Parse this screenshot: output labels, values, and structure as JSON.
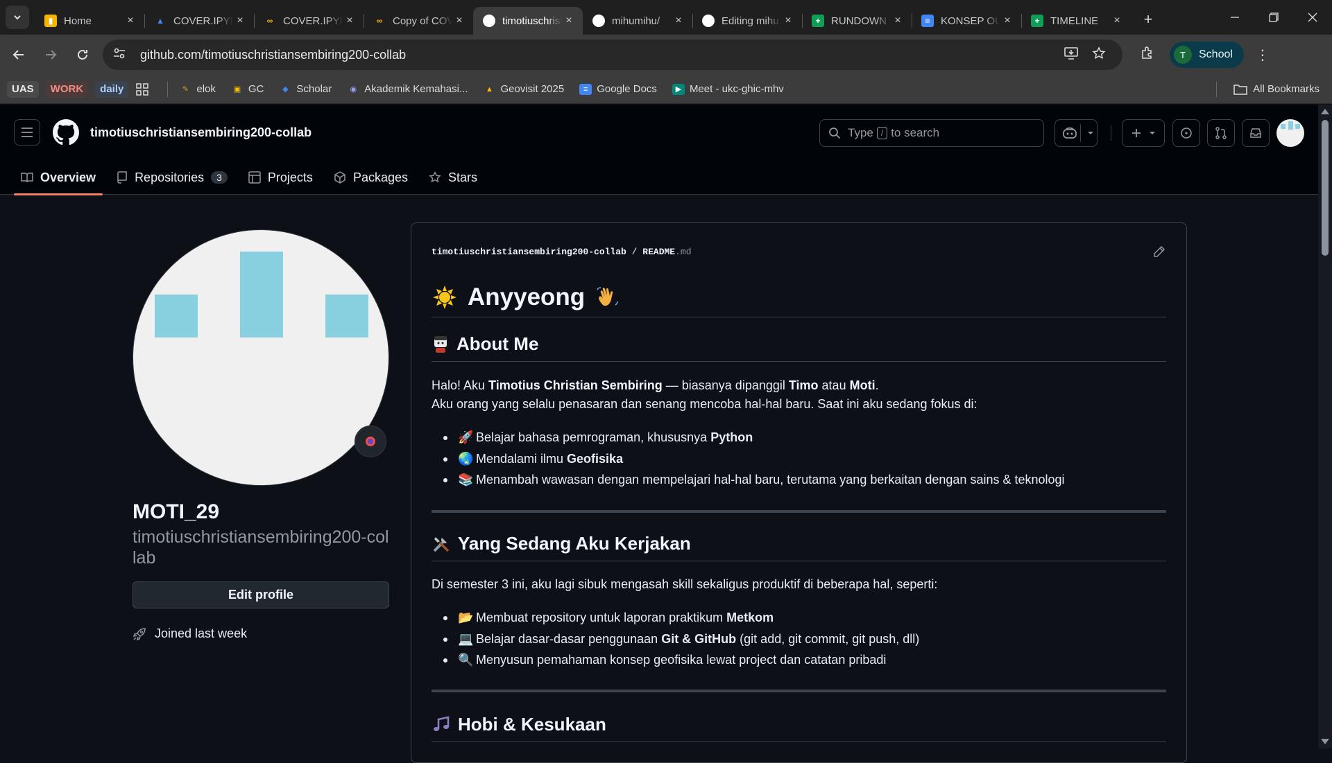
{
  "browser": {
    "tabs": [
      {
        "title": "Home",
        "icon": "slides-icon",
        "color": "#f4b400",
        "active": false
      },
      {
        "title": "COVER.IPYNB",
        "icon": "drive-icon",
        "color": "#4285f4",
        "active": false
      },
      {
        "title": "COVER.IPYNB",
        "icon": "colab-icon",
        "color": "#f9ab00",
        "active": false
      },
      {
        "title": "Copy of COVER",
        "icon": "colab-icon",
        "color": "#f9ab00",
        "active": false
      },
      {
        "title": "timotiuschristian",
        "icon": "github-icon",
        "color": "#ffffff",
        "active": true
      },
      {
        "title": "mihumihu/",
        "icon": "github-icon",
        "color": "#ffffff",
        "active": false
      },
      {
        "title": "Editing mihu",
        "icon": "github-icon",
        "color": "#ffffff",
        "active": false
      },
      {
        "title": "RUNDOWN",
        "icon": "sheets-icon",
        "color": "#0f9d58",
        "active": false
      },
      {
        "title": "KONSEP OUTLINE",
        "icon": "docs-icon",
        "color": "#4285f4",
        "active": false
      },
      {
        "title": "TIMELINE",
        "icon": "sheets-icon",
        "color": "#0f9d58",
        "active": false
      }
    ],
    "url": "github.com/timotiuschristiansembiring200-collab",
    "profile_label": "School",
    "profile_initial": "T",
    "bookmarks": {
      "tags": [
        {
          "label": "UAS",
          "color": "#e8eaed",
          "bg": "#4a4a4a"
        },
        {
          "label": "WORK",
          "color": "#f28b82",
          "bg": "#4a3a3a"
        },
        {
          "label": "daily",
          "color": "#aecbfa",
          "bg": "#39424e"
        }
      ],
      "items": [
        {
          "label": "elok",
          "icon": "pencil-icon"
        },
        {
          "label": "GC",
          "icon": "classroom-icon"
        },
        {
          "label": "Scholar",
          "icon": "scholar-icon"
        },
        {
          "label": "Akademik Kemahasi...",
          "icon": "globe-icon"
        },
        {
          "label": "Geovisit 2025",
          "icon": "drive-icon"
        },
        {
          "label": "Google Docs",
          "icon": "docs-icon"
        },
        {
          "label": "Meet - ukc-ghic-mhv",
          "icon": "meet-icon"
        }
      ],
      "all_label": "All Bookmarks"
    }
  },
  "github": {
    "username": "timotiuschristiansembiring200-collab",
    "search_prefix": "Type",
    "search_key": "/",
    "search_suffix": "to search",
    "nav": {
      "overview": "Overview",
      "repositories": "Repositories",
      "repo_count": "3",
      "projects": "Projects",
      "packages": "Packages",
      "stars": "Stars"
    },
    "profile": {
      "display_name": "MOTI_29",
      "login": "timotiuschristiansembiring200-collab",
      "edit_label": "Edit profile",
      "joined": "Joined last week"
    },
    "readme": {
      "crumb_user": "timotiuschristiansembiring200-collab",
      "crumb_sep": "/",
      "crumb_file": "README",
      "crumb_ext": ".md",
      "title": "Anyyeong",
      "about_heading": "About Me",
      "about_p1_a": "Halo! Aku ",
      "about_p1_name": "Timotius Christian Sembiring",
      "about_p1_b": " — biasanya dipanggil ",
      "about_p1_nick1": "Timo",
      "about_p1_c": " atau ",
      "about_p1_nick2": "Moti",
      "about_p1_d": ".",
      "about_p2": "Aku orang yang selalu penasaran dan senang mencoba hal-hal baru. Saat ini aku sedang fokus di:",
      "focus_items": [
        {
          "emoji": "🚀",
          "text": "Belajar bahasa pemrograman, khususnya ",
          "bold": "Python",
          "rest": ""
        },
        {
          "emoji": "🌏",
          "text": "Mendalami ilmu ",
          "bold": "Geofisika",
          "rest": ""
        },
        {
          "emoji": "📚",
          "text": "Menambah wawasan dengan mempelajari hal-hal baru, terutama yang berkaitan dengan sains & teknologi",
          "bold": "",
          "rest": ""
        }
      ],
      "work_heading": "Yang Sedang Aku Kerjakan",
      "work_intro": "Di semester 3 ini, aku lagi sibuk mengasah skill sekaligus produktif di beberapa hal, seperti:",
      "work_items": [
        {
          "emoji": "📂",
          "text": "Membuat repository untuk laporan praktikum ",
          "bold": "Metkom",
          "rest": ""
        },
        {
          "emoji": "💻",
          "text": "Belajar dasar-dasar penggunaan ",
          "bold": "Git & GitHub",
          "rest": " (git add, git commit, git push, dll)"
        },
        {
          "emoji": "🔍",
          "text": "Menyusun pemahaman konsep geofisika lewat project dan catatan pribadi",
          "bold": "",
          "rest": ""
        }
      ],
      "hobby_heading": "Hobi & Kesukaan"
    }
  },
  "colors": {
    "bg": "#0d1117",
    "header_bg": "#010409",
    "border": "#3d444d",
    "accent_underline": "#f78166",
    "avatar_bg": "#f0f0f0",
    "avatar_blocks": "#88cfe0"
  }
}
